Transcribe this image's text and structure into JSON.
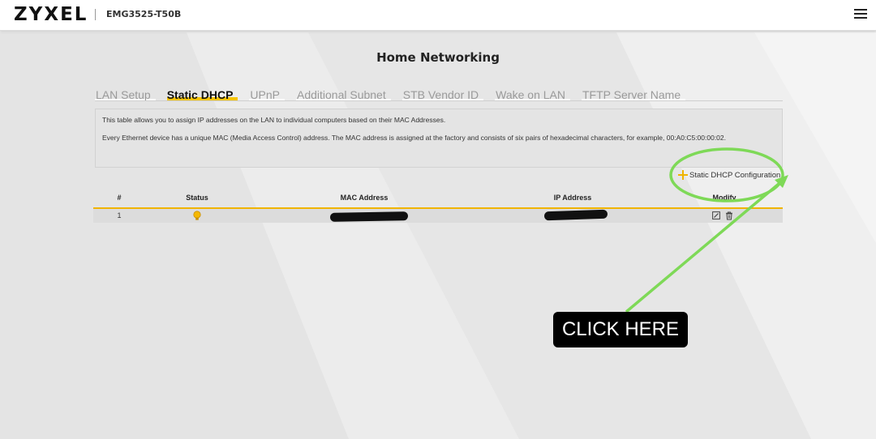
{
  "header": {
    "logo_text": "ZYXEL",
    "model": "EMG3525-T50B",
    "menu_icon": "hamburger-icon"
  },
  "page": {
    "title": "Home Networking"
  },
  "tabs": [
    {
      "label": "LAN Setup",
      "active": false
    },
    {
      "label": "Static DHCP",
      "active": true
    },
    {
      "label": "UPnP",
      "active": false
    },
    {
      "label": "Additional Subnet",
      "active": false
    },
    {
      "label": "STB Vendor ID",
      "active": false
    },
    {
      "label": "Wake on LAN",
      "active": false
    },
    {
      "label": "TFTP Server Name",
      "active": false
    }
  ],
  "info": {
    "line1": "This table allows you to assign IP addresses on the LAN to individual computers based on their MAC Addresses.",
    "line2": "Every Ethernet device has a unique MAC (Media Access Control) address. The MAC address is assigned at the factory and consists of six pairs of hexadecimal characters, for example, 00:A0:C5:00:00:02."
  },
  "actions": {
    "add_label": "Static DHCP Configuration",
    "add_icon": "plus-icon"
  },
  "table": {
    "columns": [
      "#",
      "Status",
      "MAC Address",
      "IP Address",
      "Modify"
    ],
    "rows": [
      {
        "index": "1",
        "status_icon": "bulb-icon",
        "mac": "[redacted]",
        "ip": "[redacted]",
        "modify_icons": [
          "edit-icon",
          "trash-icon"
        ]
      }
    ]
  },
  "annotation": {
    "callout_text": "CLICK HERE",
    "highlight_color": "#7ed957"
  },
  "colors": {
    "accent": "#f0b400",
    "background": "#e9e9e9"
  }
}
